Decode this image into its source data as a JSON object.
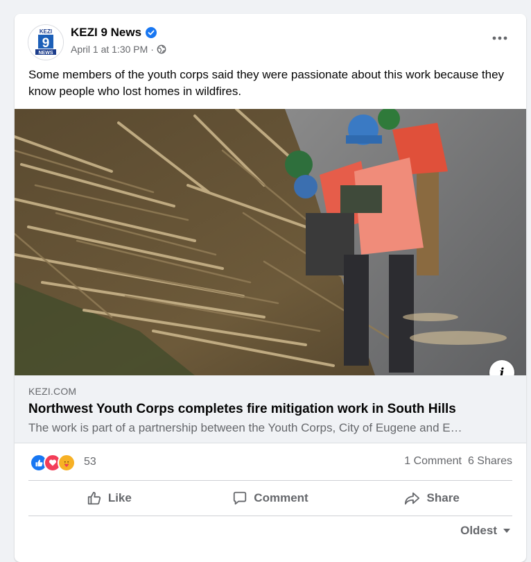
{
  "post": {
    "page_name": "KEZI 9 News",
    "timestamp": "April 1 at 1:30 PM",
    "separator": "·",
    "avatar_text_top": "KEZI",
    "avatar_text_num": "9",
    "avatar_text_bottom": "NEWS",
    "text": "Some members of the youth corps said they were passionate about this work because they know people who lost homes in wildfires."
  },
  "link": {
    "domain": "KEZI.COM",
    "title": "Northwest Youth Corps completes fire mitigation work in South Hills",
    "description": "The work is part of a partnership between the Youth Corps, City of Eugene and E…"
  },
  "stats": {
    "reaction_count": "53",
    "comments": "1 Comment",
    "shares": "6 Shares",
    "reactions": [
      "like-icon",
      "love-icon",
      "care-icon"
    ]
  },
  "actions": {
    "like": "Like",
    "comment": "Comment",
    "share": "Share"
  },
  "sort": {
    "label": "Oldest"
  },
  "colors": {
    "brand_blue": "#1877f2",
    "love_red": "#f33e58",
    "care_yellow": "#f7b125",
    "secondary_text": "#65676b"
  }
}
